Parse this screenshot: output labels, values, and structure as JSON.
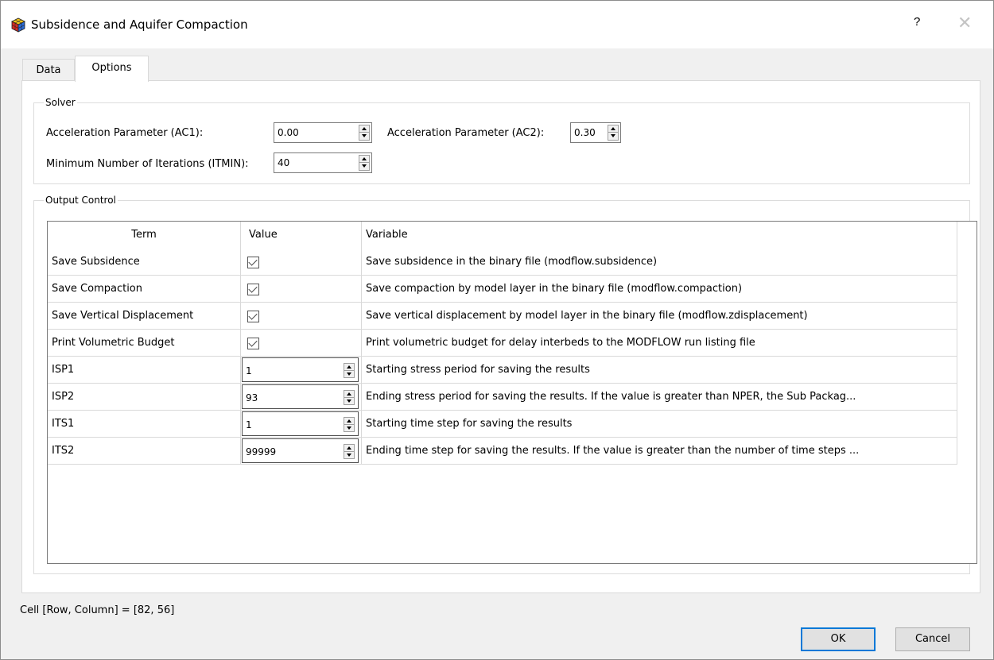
{
  "window": {
    "title": "Subsidence and Aquifer Compaction",
    "help_label": "?",
    "close_label": "✕"
  },
  "tabs": [
    {
      "label": "Data"
    },
    {
      "label": "Options"
    }
  ],
  "solver": {
    "group_label": "Solver",
    "ac1": {
      "label": "Acceleration Parameter (AC1):",
      "value": "0.00"
    },
    "ac2": {
      "label": "Acceleration Parameter (AC2):",
      "value": "0.30"
    },
    "itmin": {
      "label": "Minimum Number of Iterations (ITMIN):",
      "value": "40"
    }
  },
  "output": {
    "group_label": "Output Control",
    "columns": {
      "term": "Term",
      "value": "Value",
      "variable": "Variable"
    },
    "rows": [
      {
        "term": "Save Subsidence",
        "type": "checkbox",
        "checked": true,
        "variable": "Save subsidence in the binary file (modflow.subsidence)"
      },
      {
        "term": "Save Compaction",
        "type": "checkbox",
        "checked": true,
        "variable": "Save compaction by model layer in the binary file (modflow.compaction)"
      },
      {
        "term": "Save Vertical Displacement",
        "type": "checkbox",
        "checked": true,
        "variable": "Save vertical displacement by model layer in the binary file (modflow.zdisplacement)"
      },
      {
        "term": "Print Volumetric Budget",
        "type": "checkbox",
        "checked": true,
        "variable": "Print volumetric budget for delay interbeds to the MODFLOW run listing file"
      },
      {
        "term": "ISP1",
        "type": "spin",
        "value": "1",
        "variable": "Starting stress period for saving the results"
      },
      {
        "term": "ISP2",
        "type": "spin",
        "value": "93",
        "variable": "Ending stress period for saving the results. If the value is greater than NPER, the Sub Packag..."
      },
      {
        "term": "ITS1",
        "type": "spin",
        "value": "1",
        "variable": "Starting time step for saving the results"
      },
      {
        "term": "ITS2",
        "type": "spin",
        "value": "99999",
        "variable": "Ending time step for saving the results. If the value is greater than the number of time steps ..."
      }
    ]
  },
  "status": {
    "cell_text": "Cell [Row, Column] = [82, 56]"
  },
  "buttons": {
    "ok": "OK",
    "cancel": "Cancel"
  },
  "colors": {
    "accent": "#0078d7",
    "titlebar": "#ffffff",
    "panel": "#ffffff",
    "background": "#f0f0f0"
  }
}
